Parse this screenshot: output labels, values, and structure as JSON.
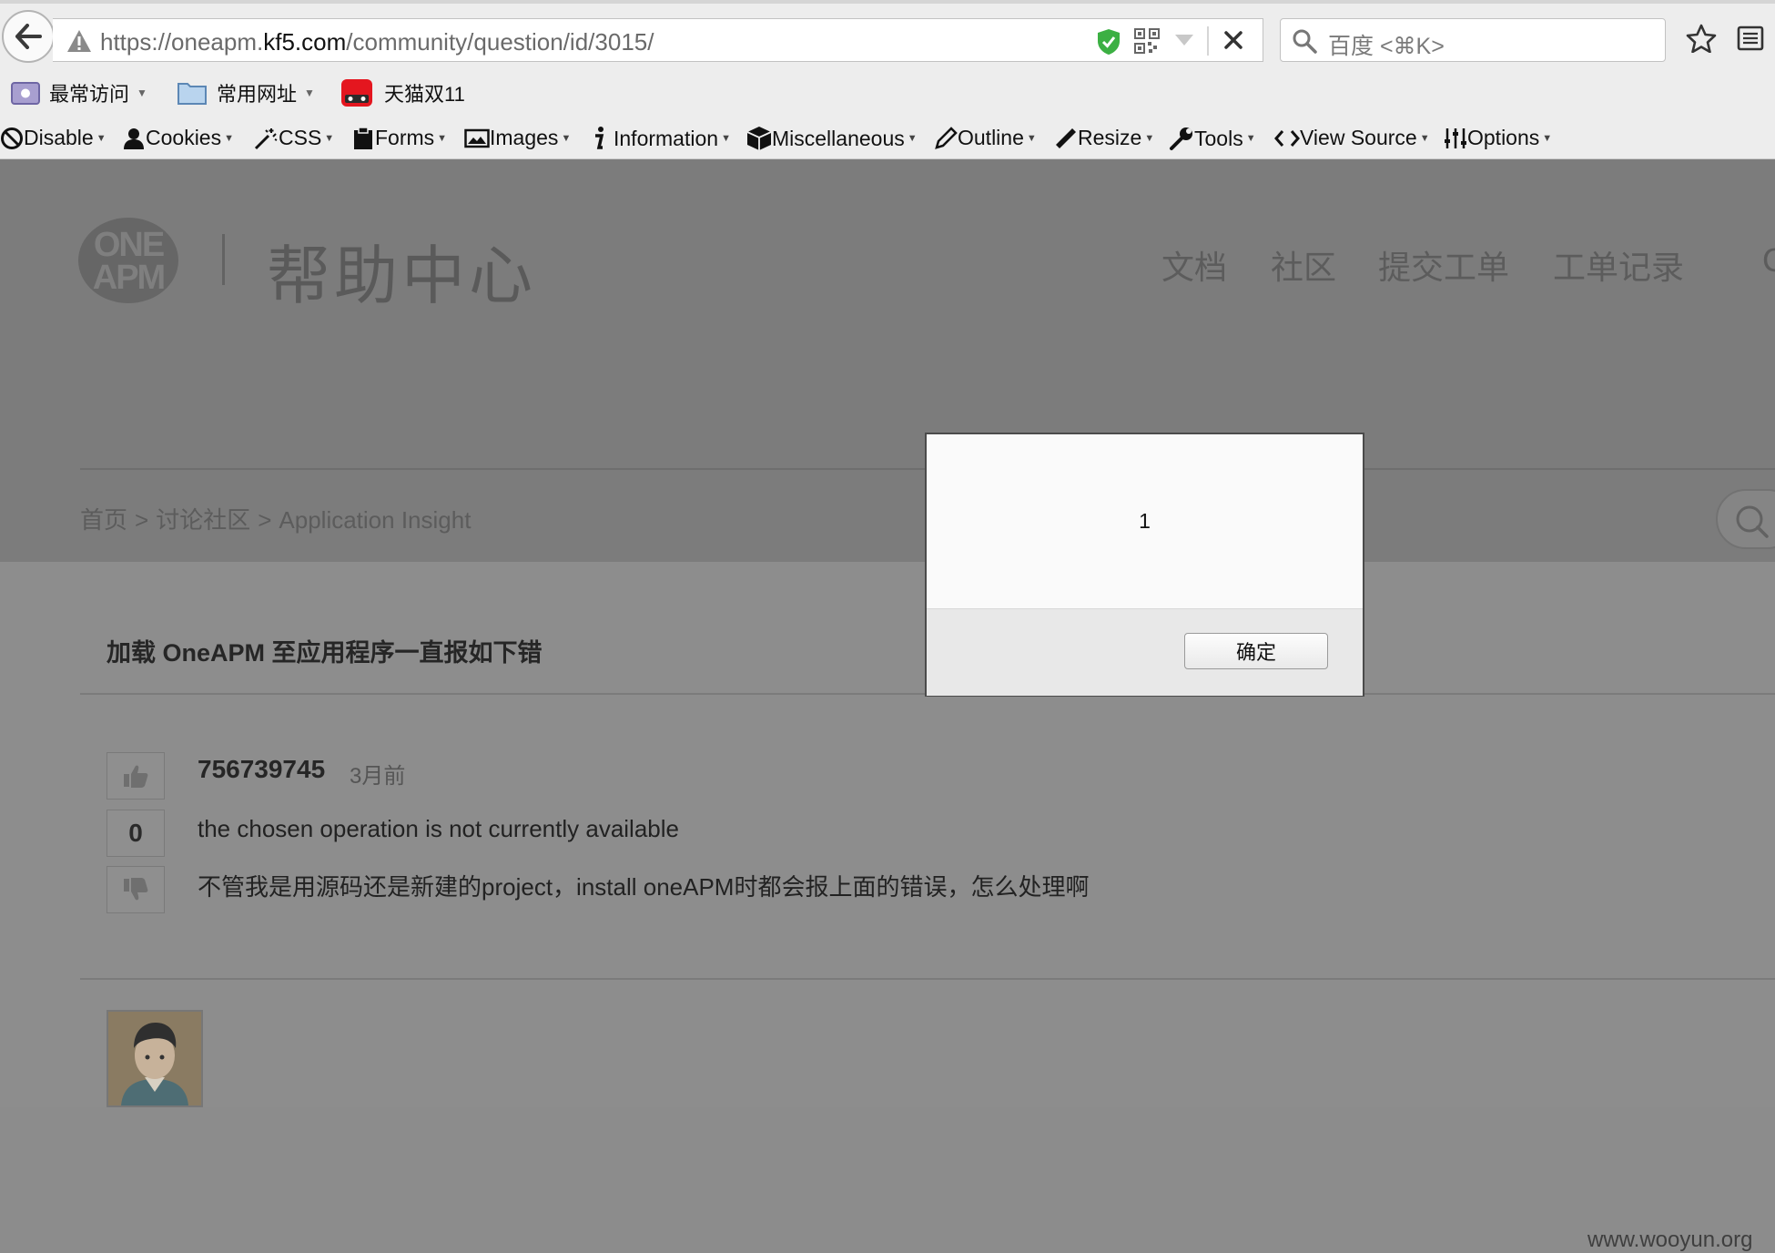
{
  "browser": {
    "url_prefix": "https://oneapm.",
    "url_domain": "kf5.com",
    "url_path": "/community/question/id/3015/",
    "search_placeholder": "百度 <⌘K>"
  },
  "bookmarks": [
    {
      "label": "最常访问"
    },
    {
      "label": "常用网址"
    },
    {
      "label": "天猫双11"
    }
  ],
  "devtoolbar": [
    {
      "label": "Disable"
    },
    {
      "label": "Cookies"
    },
    {
      "label": "CSS"
    },
    {
      "label": "Forms"
    },
    {
      "label": "Images"
    },
    {
      "label": "Information"
    },
    {
      "label": "Miscellaneous"
    },
    {
      "label": "Outline"
    },
    {
      "label": "Resize"
    },
    {
      "label": "Tools"
    },
    {
      "label": "View Source"
    },
    {
      "label": "Options"
    }
  ],
  "site": {
    "logo_line1": "ONE",
    "logo_line2": "APM",
    "brand": "帮助中心",
    "nav": [
      "文档",
      "社区",
      "提交工单",
      "工单记录",
      "C"
    ]
  },
  "breadcrumb": [
    "首页",
    ">",
    "讨论社区",
    ">",
    "Application Insight"
  ],
  "question": {
    "title": "加载 OneAPM 至应用程序一直报如下错",
    "votes": "0",
    "author": "756739745",
    "time": "3月前",
    "line1": "the chosen operation is not currently available",
    "line2": "不管我是用源码还是新建的project，install oneAPM时都会报上面的错误，怎么处理啊"
  },
  "dialog": {
    "message": "1",
    "ok_label": "确定"
  },
  "watermark": "www.wooyun.org"
}
